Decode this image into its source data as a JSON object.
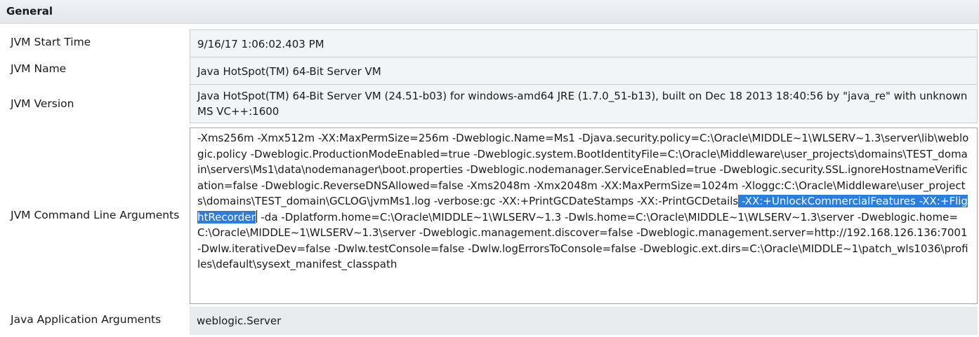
{
  "section": {
    "title": "General"
  },
  "rows": {
    "start_time": {
      "label": "JVM Start Time",
      "value": "9/16/17 1:06:02.403 PM"
    },
    "jvm_name": {
      "label": "JVM Name",
      "value": "Java HotSpot(TM) 64-Bit Server VM"
    },
    "jvm_version": {
      "label": "JVM Version",
      "value": "Java HotSpot(TM) 64-Bit Server VM (24.51-b03) for windows-amd64 JRE (1.7.0_51-b13), built on Dec 18 2013 18:40:56 by \"java_re\" with unknown MS VC++:1600"
    },
    "cmd_args": {
      "label": "JVM Command Line Arguments",
      "value_before": "-Xms256m -Xmx512m -XX:MaxPermSize=256m -Dweblogic.Name=Ms1 -Djava.security.policy=C:\\Oracle\\MIDDLE~1\\WLSERV~1.3\\server\\lib\\weblogic.policy -Dweblogic.ProductionModeEnabled=true -Dweblogic.system.BootIdentityFile=C:\\Oracle\\Middleware\\user_projects\\domains\\TEST_domain\\servers\\Ms1\\data\\nodemanager\\boot.properties -Dweblogic.nodemanager.ServiceEnabled=true -Dweblogic.security.SSL.ignoreHostnameVerification=false -Dweblogic.ReverseDNSAllowed=false -Xms2048m -Xmx2048m -XX:MaxPermSize=1024m -Xloggc:C:\\Oracle\\Middleware\\user_projects\\domains\\TEST_domain\\GCLOG\\jvmMs1.log -verbose:gc -XX:+PrintGCDateStamps -XX:-PrintGCDetails",
      "value_selected": " -XX:+UnlockCommercialFeatures -XX:+FlightRecorder",
      "value_after": " -da -Dplatform.home=C:\\Oracle\\MIDDLE~1\\WLSERV~1.3 -Dwls.home=C:\\Oracle\\MIDDLE~1\\WLSERV~1.3\\server -Dweblogic.home=C:\\Oracle\\MIDDLE~1\\WLSERV~1.3\\server -Dweblogic.management.discover=false -Dweblogic.management.server=http://192.168.126.136:7001 -Dwlw.iterativeDev=false -Dwlw.testConsole=false -Dwlw.logErrorsToConsole=false -Dweblogic.ext.dirs=C:\\Oracle\\MIDDLE~1\\patch_wls1036\\profiles\\default\\sysext_manifest_classpath"
    },
    "app_args": {
      "label": "Java Application Arguments",
      "value": "weblogic.Server"
    }
  },
  "colors": {
    "selection": "#2a7de1",
    "field_background": "#f3f4f6",
    "header_background": "#e6e9ee"
  }
}
